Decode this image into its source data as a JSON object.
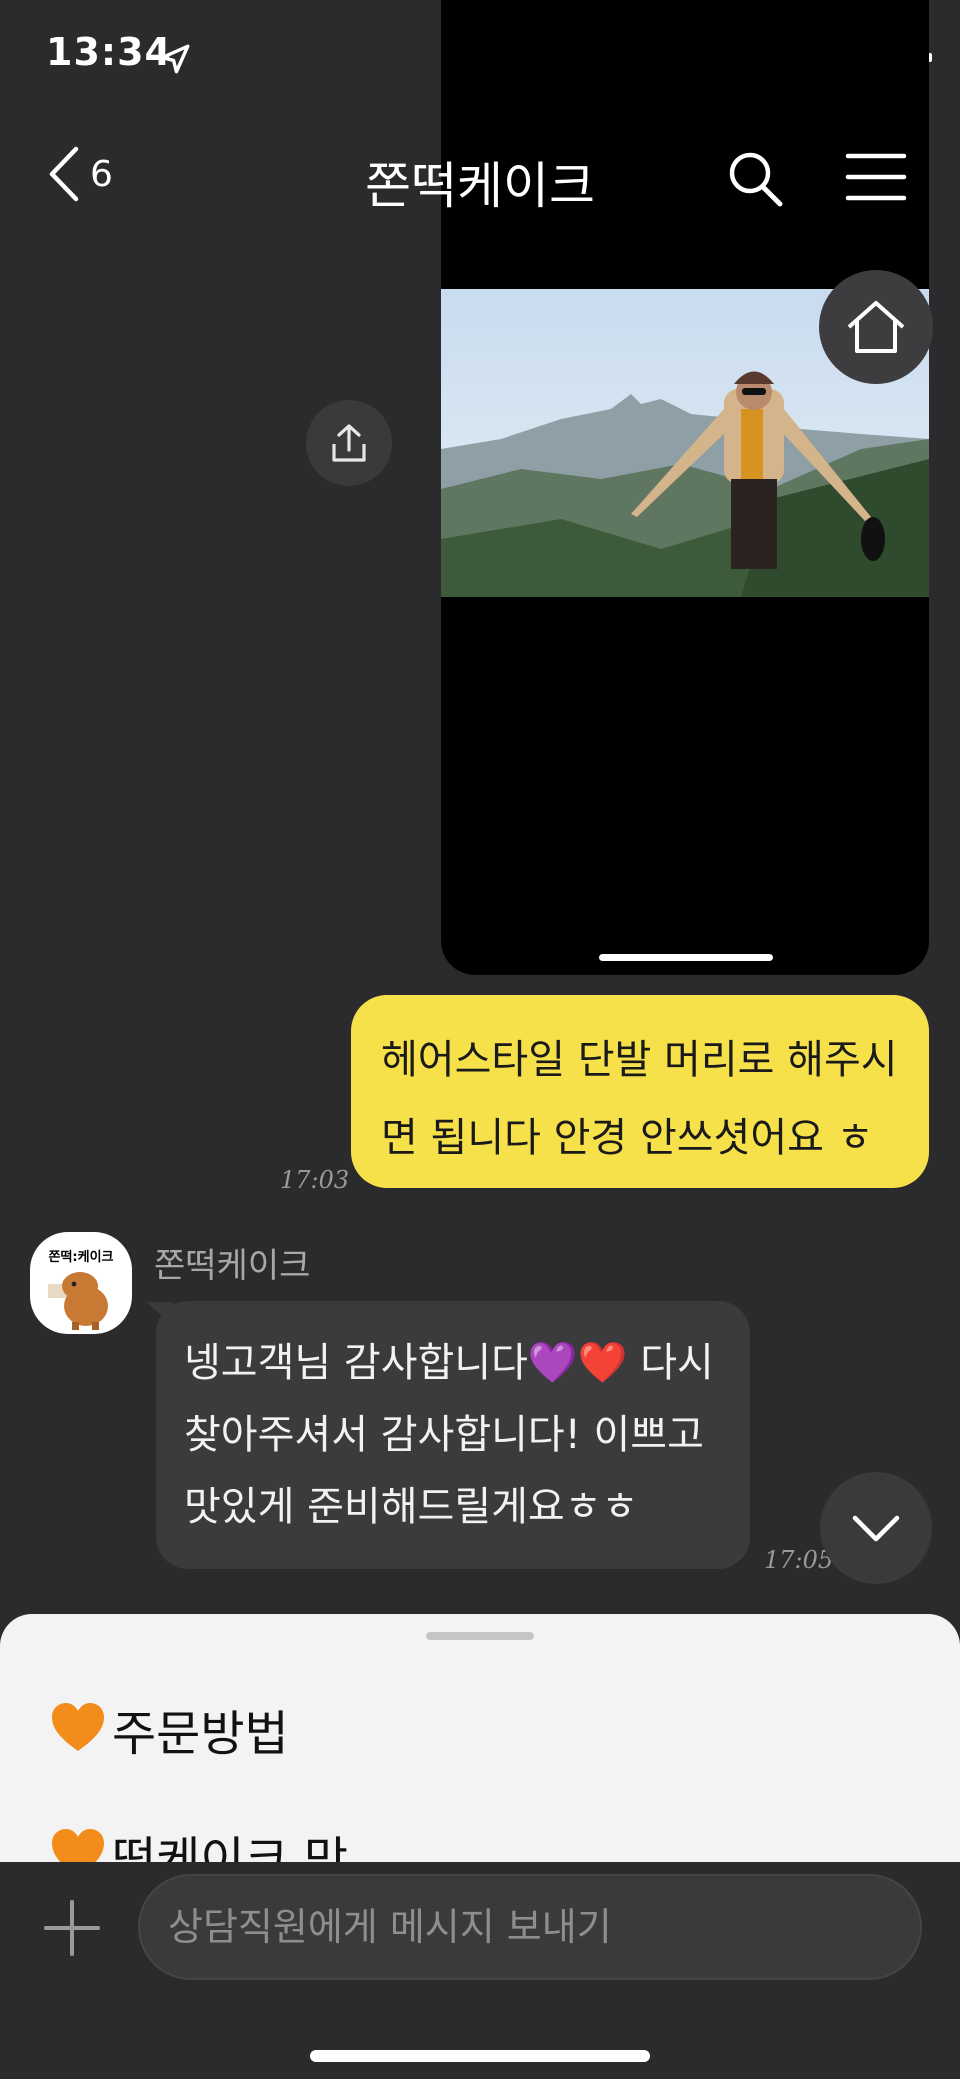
{
  "status_bar": {
    "time": "13:34"
  },
  "header": {
    "back_count": "6",
    "title": "쫀떡케이크"
  },
  "messages": {
    "mine": {
      "line1": "헤어스타일 단발 머리로 해주시",
      "line2": "면 됩니다 안경 안쓰셧어요 ㅎ",
      "time": "17:03"
    },
    "theirs": {
      "sender": "쫀떡케이크",
      "line1": "넹고객님 감사합니다💜❤️ 다시",
      "line2": "찾아주셔서 감사합니다! 이쁘고",
      "line3": "맛있게 준비해드릴게요ㅎㅎ",
      "time": "17:05"
    },
    "avatar_text": "쫀떡:케이크"
  },
  "sheet": {
    "items": [
      {
        "label": "주문방법"
      },
      {
        "label": "떡케이크 맛"
      }
    ]
  },
  "input": {
    "placeholder": "상담직원에게 메시지 보내기"
  },
  "colors": {
    "my_bubble": "#f7e14a",
    "their_bubble": "#3b3b3d",
    "background": "#2b2b2d"
  }
}
